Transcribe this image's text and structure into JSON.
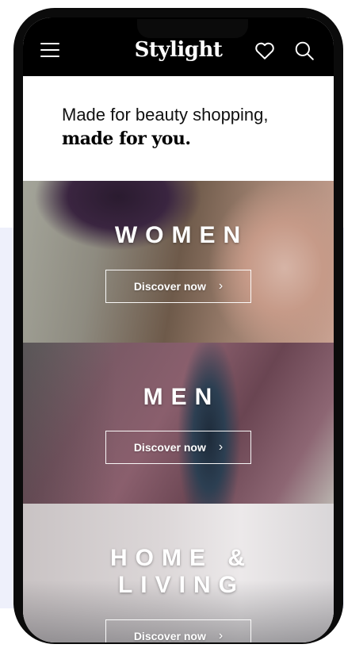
{
  "header": {
    "logo": "Stylight",
    "menu_icon": "hamburger-menu-icon",
    "wishlist_icon": "heart-icon",
    "search_icon": "search-icon",
    "background": "#000000"
  },
  "hero": {
    "line1": "Made for beauty shopping,",
    "line2": "made for you."
  },
  "categories": [
    {
      "title": "WOMEN",
      "cta": "Discover now"
    },
    {
      "title": "MEN",
      "cta": "Discover now"
    },
    {
      "title_line1": "HOME &",
      "title_line2": "LIVING",
      "cta": "Discover now"
    }
  ],
  "icons": {
    "cta_chevron": "chevron-right-icon",
    "cta_chevron_glyph": "›"
  }
}
